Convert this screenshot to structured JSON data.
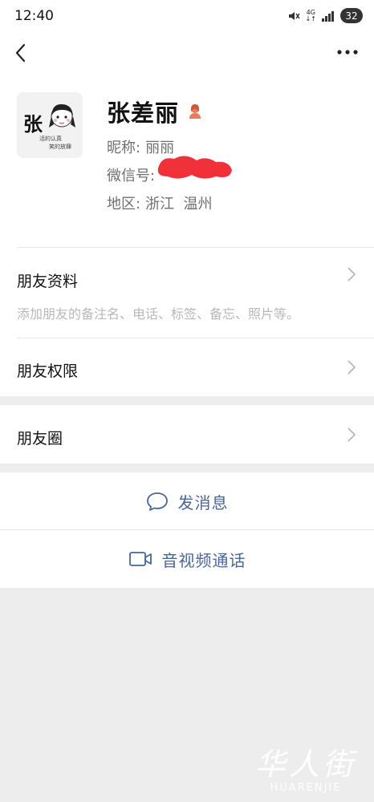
{
  "status_bar": {
    "time": "12:40",
    "network": "4G",
    "battery": "32",
    "icons": [
      "mute-icon",
      "signal-icon"
    ]
  },
  "nav": {
    "back_icon": "chevron-left-icon",
    "more_icon": "more-dots-icon"
  },
  "profile": {
    "avatar_text": "张",
    "avatar_caption_1": "活的认真",
    "avatar_caption_2": "笑的放肆",
    "name": "张差丽",
    "gender_icon": "female-user-icon",
    "nickname_label": "昵称:",
    "nickname_value": "丽丽",
    "wechat_id_label": "微信号:",
    "region_label": "地区:",
    "region_value": "浙江  温州"
  },
  "cells": {
    "friend_info": {
      "title": "朋友资料",
      "desc": "添加朋友的备注名、电话、标签、备忘、照片等。"
    },
    "permissions": {
      "title": "朋友权限"
    },
    "moments": {
      "title": "朋友圈"
    }
  },
  "actions": {
    "message": "发消息",
    "video_call": "音视频通话"
  },
  "watermark": {
    "text": "华人街",
    "sub": "HUARENJIE"
  },
  "colors": {
    "link_blue": "#4a6694",
    "background": "#ededed",
    "gender_female": "#e97c5c",
    "redaction": "#f0313a"
  }
}
